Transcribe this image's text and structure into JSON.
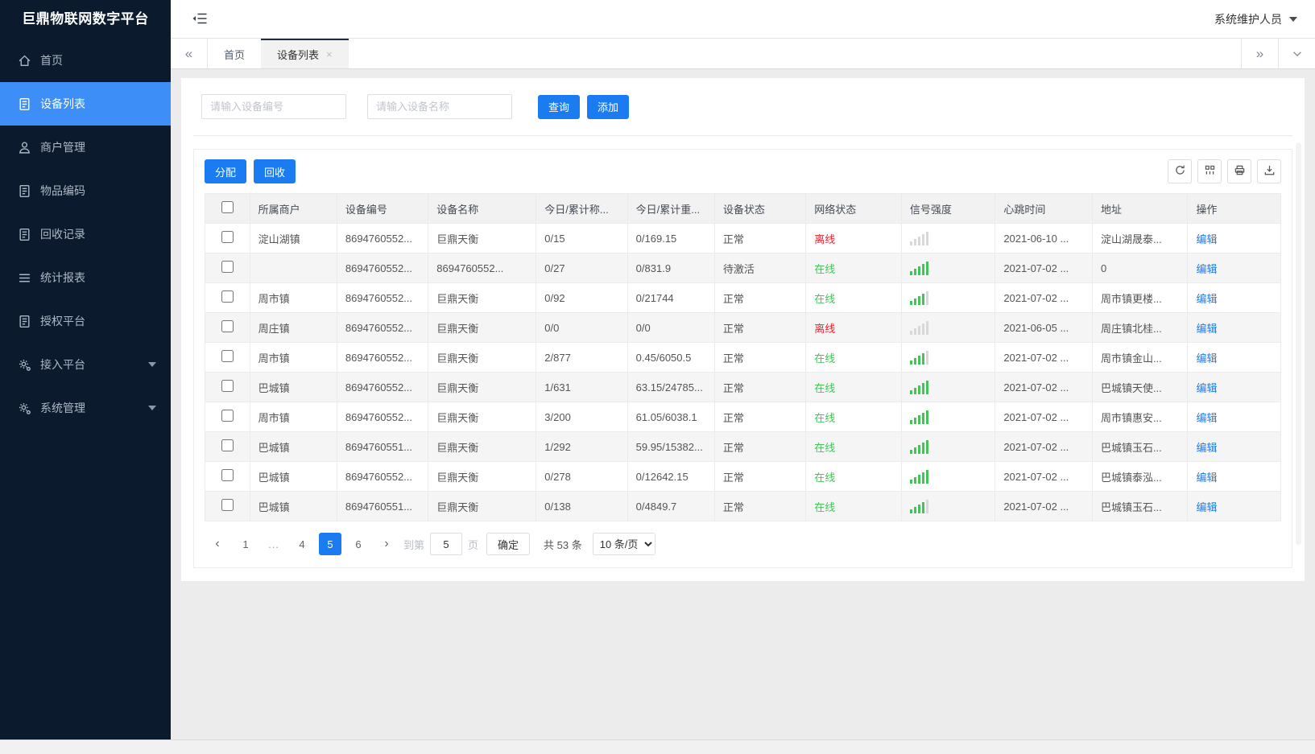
{
  "app": {
    "title": "巨鼎物联网数字平台",
    "user_name": "系统维护人员"
  },
  "sidebar": {
    "items": [
      {
        "label": "首页",
        "icon": "home",
        "active": false,
        "caret": false
      },
      {
        "label": "设备列表",
        "icon": "doc",
        "active": true,
        "caret": false
      },
      {
        "label": "商户管理",
        "icon": "user",
        "active": false,
        "caret": false
      },
      {
        "label": "物品编码",
        "icon": "doc",
        "active": false,
        "caret": false
      },
      {
        "label": "回收记录",
        "icon": "doc",
        "active": false,
        "caret": false
      },
      {
        "label": "统计报表",
        "icon": "lines",
        "active": false,
        "caret": false
      },
      {
        "label": "授权平台",
        "icon": "doc",
        "active": false,
        "caret": false
      },
      {
        "label": "接入平台",
        "icon": "gear",
        "active": false,
        "caret": true
      },
      {
        "label": "系统管理",
        "icon": "gear",
        "active": false,
        "caret": true
      }
    ]
  },
  "tabbar": {
    "tabs": [
      {
        "label": "首页",
        "active": false,
        "closable": false
      },
      {
        "label": "设备列表",
        "active": true,
        "closable": true
      }
    ],
    "nav_icons": [
      "double-chevron-left",
      "double-chevron-right",
      "chevron-down"
    ],
    "close_glyph": "×"
  },
  "search": {
    "device_no_placeholder": "请输入设备编号",
    "device_name_placeholder": "请输入设备名称",
    "query_label": "查询",
    "add_label": "添加"
  },
  "toolbar": {
    "assign_label": "分配",
    "recycle_label": "回收",
    "icons": [
      "refresh",
      "columns",
      "print",
      "download"
    ]
  },
  "table": {
    "columns": [
      "所属商户",
      "设备编号",
      "设备名称",
      "今日/累计称...",
      "今日/累计重...",
      "设备状态",
      "网络状态",
      "信号强度",
      "心跳时间",
      "地址",
      "操作"
    ],
    "rows": [
      {
        "merchant": "淀山湖镇",
        "device_no": "8694760552...",
        "device_name": "巨鼎天衡",
        "count": "0/15",
        "weight": "0/169.15",
        "device_status": "正常",
        "net_status": "离线",
        "online": false,
        "signal": 0,
        "heartbeat": "2021-06-10 ...",
        "address": "淀山湖晟泰...",
        "action": "编辑"
      },
      {
        "merchant": "",
        "device_no": "8694760552...",
        "device_name": "8694760552...",
        "count": "0/27",
        "weight": "0/831.9",
        "device_status": "待激活",
        "net_status": "在线",
        "online": true,
        "signal": 5,
        "heartbeat": "2021-07-02 ...",
        "address": "0",
        "action": "编辑"
      },
      {
        "merchant": "周市镇",
        "device_no": "8694760552...",
        "device_name": "巨鼎天衡",
        "count": "0/92",
        "weight": "0/21744",
        "device_status": "正常",
        "net_status": "在线",
        "online": true,
        "signal": 4,
        "heartbeat": "2021-07-02 ...",
        "address": "周市镇更楼...",
        "action": "编辑"
      },
      {
        "merchant": "周庄镇",
        "device_no": "8694760552...",
        "device_name": "巨鼎天衡",
        "count": "0/0",
        "weight": "0/0",
        "device_status": "正常",
        "net_status": "离线",
        "online": false,
        "signal": 0,
        "heartbeat": "2021-06-05 ...",
        "address": "周庄镇北桂...",
        "action": "编辑"
      },
      {
        "merchant": "周市镇",
        "device_no": "8694760552...",
        "device_name": "巨鼎天衡",
        "count": "2/877",
        "weight": "0.45/6050.5",
        "device_status": "正常",
        "net_status": "在线",
        "online": true,
        "signal": 4,
        "heartbeat": "2021-07-02 ...",
        "address": "周市镇金山...",
        "action": "编辑"
      },
      {
        "merchant": "巴城镇",
        "device_no": "8694760552...",
        "device_name": "巨鼎天衡",
        "count": "1/631",
        "weight": "63.15/24785...",
        "device_status": "正常",
        "net_status": "在线",
        "online": true,
        "signal": 5,
        "heartbeat": "2021-07-02 ...",
        "address": "巴城镇天使...",
        "action": "编辑"
      },
      {
        "merchant": "周市镇",
        "device_no": "8694760552...",
        "device_name": "巨鼎天衡",
        "count": "3/200",
        "weight": "61.05/6038.1",
        "device_status": "正常",
        "net_status": "在线",
        "online": true,
        "signal": 5,
        "heartbeat": "2021-07-02 ...",
        "address": "周市镇惠安...",
        "action": "编辑"
      },
      {
        "merchant": "巴城镇",
        "device_no": "8694760551...",
        "device_name": "巨鼎天衡",
        "count": "1/292",
        "weight": "59.95/15382...",
        "device_status": "正常",
        "net_status": "在线",
        "online": true,
        "signal": 5,
        "heartbeat": "2021-07-02 ...",
        "address": "巴城镇玉石...",
        "action": "编辑"
      },
      {
        "merchant": "巴城镇",
        "device_no": "8694760552...",
        "device_name": "巨鼎天衡",
        "count": "0/278",
        "weight": "0/12642.15",
        "device_status": "正常",
        "net_status": "在线",
        "online": true,
        "signal": 5,
        "heartbeat": "2021-07-02 ...",
        "address": "巴城镇泰泓...",
        "action": "编辑"
      },
      {
        "merchant": "巴城镇",
        "device_no": "8694760551...",
        "device_name": "巨鼎天衡",
        "count": "0/138",
        "weight": "0/4849.7",
        "device_status": "正常",
        "net_status": "在线",
        "online": true,
        "signal": 4,
        "heartbeat": "2021-07-02 ...",
        "address": "巴城镇玉石...",
        "action": "编辑"
      }
    ]
  },
  "pagination": {
    "prev_glyph": "‹",
    "next_glyph": "›",
    "pages": [
      "1",
      "...",
      "4",
      "5",
      "6"
    ],
    "active_page": "5",
    "goto_label": "到第",
    "goto_value": "5",
    "unit_label": "页",
    "confirm_label": "确定",
    "total_label": "共 53 条",
    "page_size_label": "10 条/页"
  },
  "colors": {
    "primary": "#1b7cf2",
    "sidebar_bg": "#0b1a2c",
    "sidebar_active": "#3e8ef7",
    "online_green": "#45c35a",
    "offline_red": "#f5222d"
  }
}
